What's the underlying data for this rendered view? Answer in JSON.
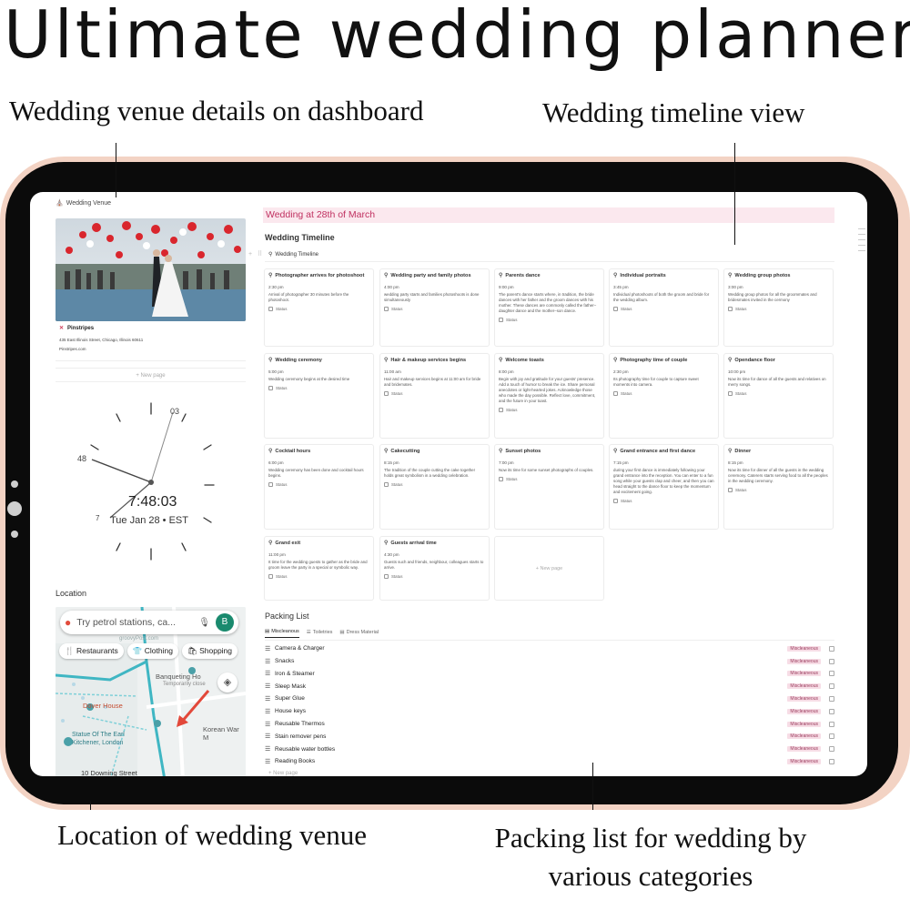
{
  "headline": "Ultimate wedding planner",
  "captions": {
    "venue": "Wedding venue details on dashboard",
    "timeline": "Wedding timeline view",
    "location": "Location of wedding venue",
    "packing": "Packing list for wedding by various categories"
  },
  "sidebar": {
    "venue_heading": "Wedding Venue",
    "venue_name": "Pinstripes",
    "venue_address": "435 East Illinois Street, Chicago, Illinois 60611",
    "venue_site": "Pinstripes.com",
    "new_page": "+ New page",
    "clock": {
      "time": "7:48:03",
      "date": "Tue Jan 28 • EST",
      "label_top": "03",
      "label_left": "48",
      "label_bottom_left": "7"
    },
    "location_label": "Location",
    "map": {
      "search_placeholder": "Try petrol stations, ca...",
      "avatar_letter": "B",
      "chips": [
        "Restaurants",
        "Clothing",
        "Shopping"
      ],
      "watermark": "groovyPost.com",
      "places": [
        "Banqueting Ho",
        "Temporarily close",
        "Dover House",
        "Statue Of The Earl Kitchener, London",
        "Korean War M",
        "10 Downing Street"
      ]
    }
  },
  "main": {
    "title": "Wedding at 28th of March",
    "timeline_heading": "Wedding Timeline",
    "timeline_tab": "Wedding Timeline",
    "row_handles": "+ ⠿",
    "status_label": "Status",
    "new_page": "+ New page",
    "cards": [
      {
        "title": "Photographer arrives for photoshoot",
        "time": "2:30 pm",
        "desc": "Arrival of photographer 30 minutes before the photoshoot."
      },
      {
        "title": "Wedding party and family photos",
        "time": "4:00 pm",
        "desc": "wedding party starts and families photoshoots is done simultaneously"
      },
      {
        "title": "Parents dance",
        "time": "9:00 pm",
        "desc": "The parent's dance starts where, in tradition, the bride dances with her father and the groom dances with his mother. These dances are commonly called the father–daughter dance and the mother–son dance."
      },
      {
        "title": "Individual portraits",
        "time": "3:45 pm",
        "desc": "Individual photoshoots of both the groom and bride for the wedding album."
      },
      {
        "title": "Wedding group photos",
        "time": "3:00 pm",
        "desc": "Wedding group photos for all the groommates and bridesmates invited in the cermony"
      },
      {
        "title": "Wedding ceremony",
        "time": "5:00 pm",
        "desc": "Wedding ceremony begins at the desired time"
      },
      {
        "title": "Hair & makeup services begins",
        "time": "11:00 am",
        "desc": "Hair and makeup services begins at 11:00 am for bride and bridemates."
      },
      {
        "title": "Welcome toasts",
        "time": "8:00 pm",
        "desc": "Begin with joy and gratitude for your guests' presence. Add a touch of humor to break the ice. Share personal anecdotes or light-hearted jokes. Acknowledge those who made the day possible. Reflect love, commitment, and the future in your toast."
      },
      {
        "title": "Photography time of couple",
        "time": "2:30 pm",
        "desc": "Its photography time for couple to capture sweet moments into camera."
      },
      {
        "title": "Opendance floor",
        "time": "10:00 pm",
        "desc": "Now its time for dance of all the guests and relatives on merry songs."
      },
      {
        "title": "Cocktail hours",
        "time": "6:00 pm",
        "desc": "Wedding ceremony has been done and cocktail hours begins."
      },
      {
        "title": "Cakecutting",
        "time": "8:15 pm",
        "desc": "The tradition of the couple cutting the cake together holds great symbolism in a wedding celebration."
      },
      {
        "title": "Sunset photos",
        "time": "7:00 pm",
        "desc": "Now its time for some sunset photographs of couples."
      },
      {
        "title": "Grand entrance and first dance",
        "time": "7:15 pm",
        "desc": "during your first dance is immediately following your grand entrance into the reception. You can enter to a fun song while your guests clap and cheer, and then you can head straight to the dance floor to keep the momentum and excitement going."
      },
      {
        "title": "Dinner",
        "time": "8:15 pm",
        "desc": "Now its time for dinner of all the guests in the wedding ceremony. Caterers starts serving food to all the peoples in the wedding ceremony."
      },
      {
        "title": "Grand exit",
        "time": "11:00 pm",
        "desc": "It time for the wedding guests to gather as the bride and groom leave the party in a special or symbolic way."
      },
      {
        "title": "Guests arrival time",
        "time": "4:30 pm",
        "desc": "Guests such and friends, neighbour, colleagues starts to arrive."
      }
    ],
    "packing": {
      "heading": "Packing List",
      "tabs": [
        "Miscleanous",
        "Toiletries",
        "Dress Material"
      ],
      "items": [
        "Camera & Charger",
        "Snacks",
        "Iron & Steamer",
        "Sleep Mask",
        "Super Glue",
        "House keys",
        "Reusable Thermos",
        "Stain remover pens",
        "Reusable water bottles",
        "Reading Books"
      ],
      "tag": "Miscleaneous",
      "new_page": "+ New page"
    }
  }
}
